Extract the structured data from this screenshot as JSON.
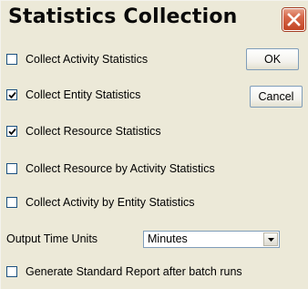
{
  "window": {
    "title": "Statistics Collection"
  },
  "options": [
    {
      "label": "Collect Activity Statistics",
      "checked": false
    },
    {
      "label": "Collect Entity Statistics",
      "checked": true
    },
    {
      "label": "Collect Resource Statistics",
      "checked": true
    },
    {
      "label": "Collect Resource by Activity Statistics",
      "checked": false
    },
    {
      "label": "Collect Activity by Entity Statistics",
      "checked": false
    }
  ],
  "buttons": {
    "ok_label": "OK",
    "cancel_label": "Cancel"
  },
  "time_units": {
    "label": "Output Time Units",
    "selected": "Minutes"
  },
  "report_option": {
    "label": "Generate Standard Report after batch runs",
    "checked": false
  },
  "icons": {
    "close": "close-icon",
    "checkmark": "checkmark-icon",
    "dropdown": "chevron-down-icon"
  },
  "colors": {
    "close_button": "#c24424",
    "dialog_background": "#ece9d8",
    "checkbox_border": "#1c5180"
  }
}
